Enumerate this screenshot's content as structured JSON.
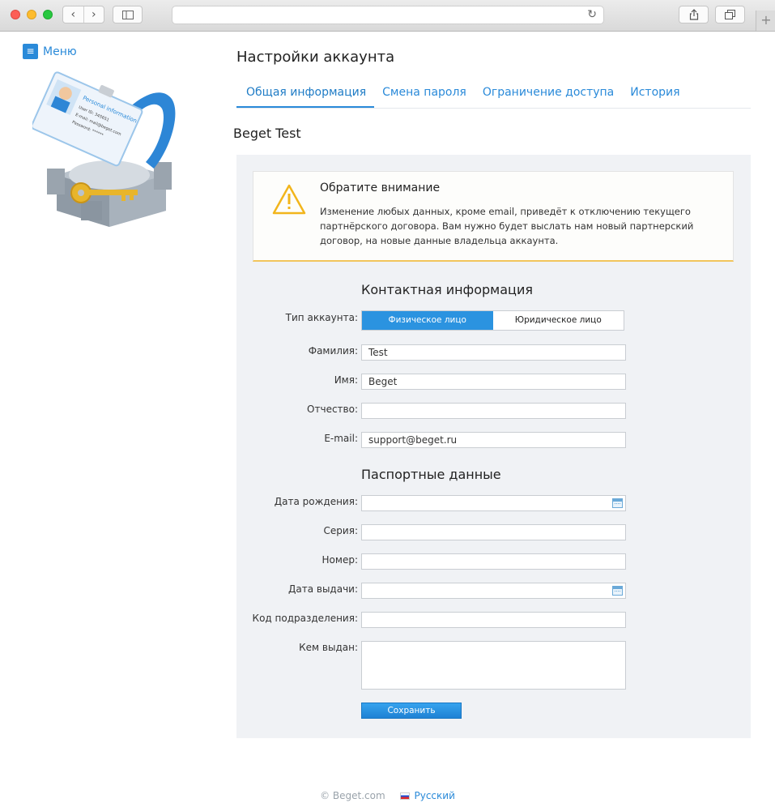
{
  "browser": {
    "back_icon": "chevron-left-icon",
    "forward_icon": "chevron-right-icon",
    "reload_icon": "reload-icon",
    "new_tab_symbol": "+"
  },
  "sidebar": {
    "menu_label": "Меню"
  },
  "page": {
    "title": "Настройки аккаунта",
    "account_name": "Beget Test"
  },
  "tabs": [
    {
      "label": "Общая информация",
      "active": true
    },
    {
      "label": "Смена пароля",
      "active": false
    },
    {
      "label": "Ограничение доступа",
      "active": false
    },
    {
      "label": "История",
      "active": false
    }
  ],
  "notice": {
    "title": "Обратите внимание",
    "text": "Изменение любых данных, кроме email, приведёт к отключению текущего партнёрского договора. Вам нужно будет выслать нам новый партнерский договор, на новые данные владельца аккаунта."
  },
  "contact": {
    "section_title": "Контактная информация",
    "account_type_label": "Тип аккаунта:",
    "account_type_options": [
      "Физическое лицо",
      "Юридическое лицо"
    ],
    "account_type_selected": "Физическое лицо",
    "last_name_label": "Фамилия:",
    "last_name_value": "Test",
    "first_name_label": "Имя:",
    "first_name_value": "Beget",
    "middle_name_label": "Отчество:",
    "middle_name_value": "",
    "email_label": "E-mail:",
    "email_value": "support@beget.ru"
  },
  "passport": {
    "section_title": "Паспортные данные",
    "birth_date_label": "Дата рождения:",
    "series_label": "Серия:",
    "number_label": "Номер:",
    "issue_date_label": "Дата выдачи:",
    "division_code_label": "Код подразделения:",
    "issued_by_label": "Кем выдан:"
  },
  "actions": {
    "save_label": "Сохранить"
  },
  "illustration": {
    "card_title": "Personal information",
    "user_id": "User ID: 345651",
    "email_line": "E-mail: mail@beget.com",
    "password_line": "Password: ******"
  },
  "footer": {
    "copyright": "© Beget.com",
    "language": "Русский"
  },
  "colors": {
    "accent": "#2a8ad9",
    "panel_bg": "#f0f2f5",
    "warning": "#f2c55c"
  }
}
